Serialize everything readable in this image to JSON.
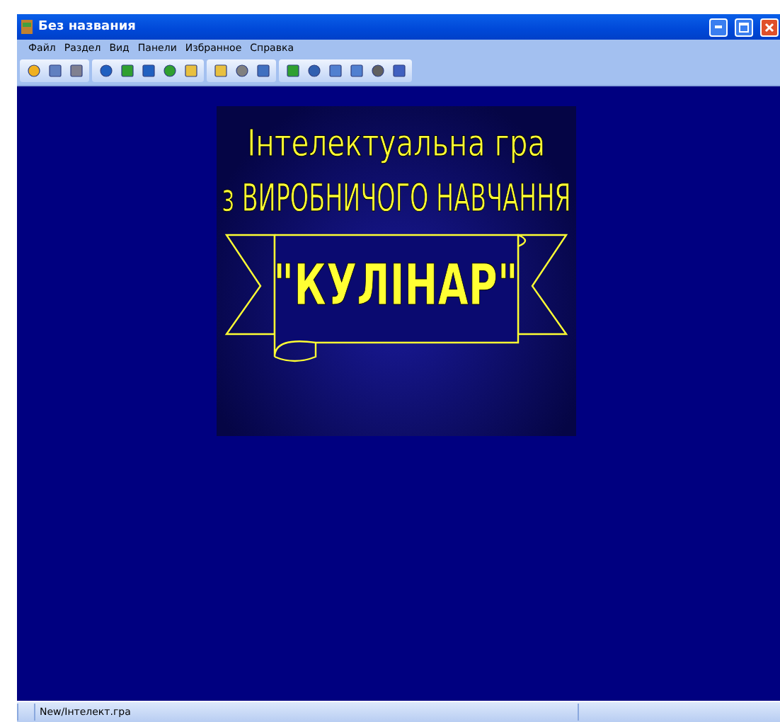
{
  "window": {
    "title": "Без названия"
  },
  "menu": [
    "Файл",
    "Раздел",
    "Вид",
    "Панели",
    "Избранное",
    "Справка"
  ],
  "slide": {
    "line_1": "Інтелектуальна гра",
    "line_2": "з ВИРОБНИЧОГО НАВЧАННЯ",
    "banner": "\"КУЛІНАР\""
  },
  "status_bar": {
    "path": "New/Інтелект.гра"
  }
}
